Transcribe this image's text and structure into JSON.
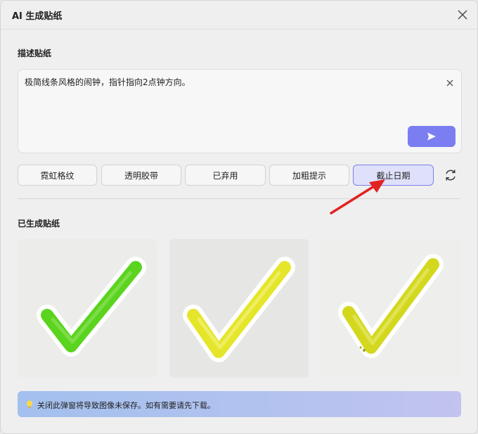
{
  "dialog": {
    "title": "AI 生成贴纸"
  },
  "prompt_section": {
    "label": "描述贴纸",
    "text": "极简线条风格的闹钟，指针指向2点钟方向。"
  },
  "style_chips": [
    {
      "label": "霓虹格纹",
      "active": false
    },
    {
      "label": "透明胶带",
      "active": false
    },
    {
      "label": "已弃用",
      "active": false
    },
    {
      "label": "加粗提示",
      "active": false
    },
    {
      "label": "截止日期",
      "active": true
    }
  ],
  "generated_section": {
    "label": "已生成贴纸",
    "stickers": [
      {
        "icon": "checkmark-icon",
        "color": "#5ad41e"
      },
      {
        "icon": "checkmark-icon",
        "color": "#e5e52a"
      },
      {
        "icon": "checkmark-icon",
        "color": "#d3d81f"
      }
    ]
  },
  "notice": {
    "text": "关闭此弹窗将导致图像未保存。如有需要请先下载。"
  },
  "colors": {
    "accent": "#7b7ef0",
    "active_chip_bg": "#dfe1fb",
    "annotation_arrow": "#e32222"
  }
}
